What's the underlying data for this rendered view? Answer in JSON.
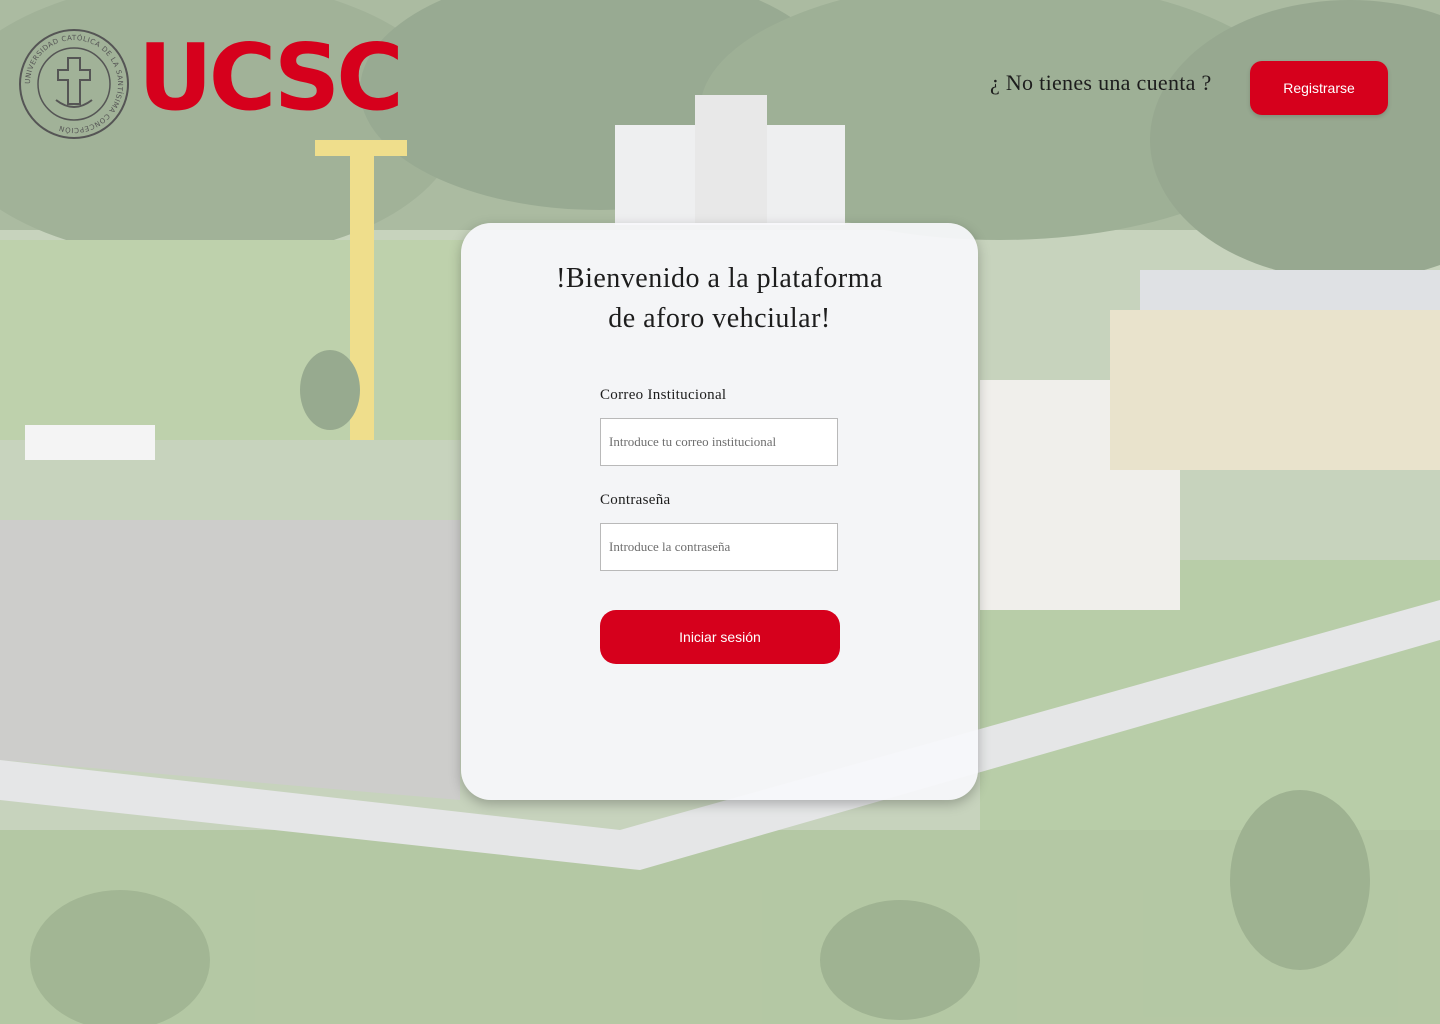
{
  "brand": {
    "wordmark": "UCSC",
    "seal_text": "UNIVERSIDAD CATÓLICA DE LA SANTÍSIMA CONCEPCIÓN",
    "accent_color": "#d6001c"
  },
  "header": {
    "signup_prompt": "¿ No tienes una cuenta ?",
    "register_label": "Registrarse"
  },
  "login": {
    "welcome_line1": "!Bienvenido a la plataforma",
    "welcome_line2": "de aforo vehciular!",
    "email_label": "Correo Institucional",
    "email_placeholder": "Introduce tu correo institucional",
    "password_label": "Contraseña",
    "password_placeholder": "Introduce la contraseña",
    "submit_label": "Iniciar sesión"
  }
}
